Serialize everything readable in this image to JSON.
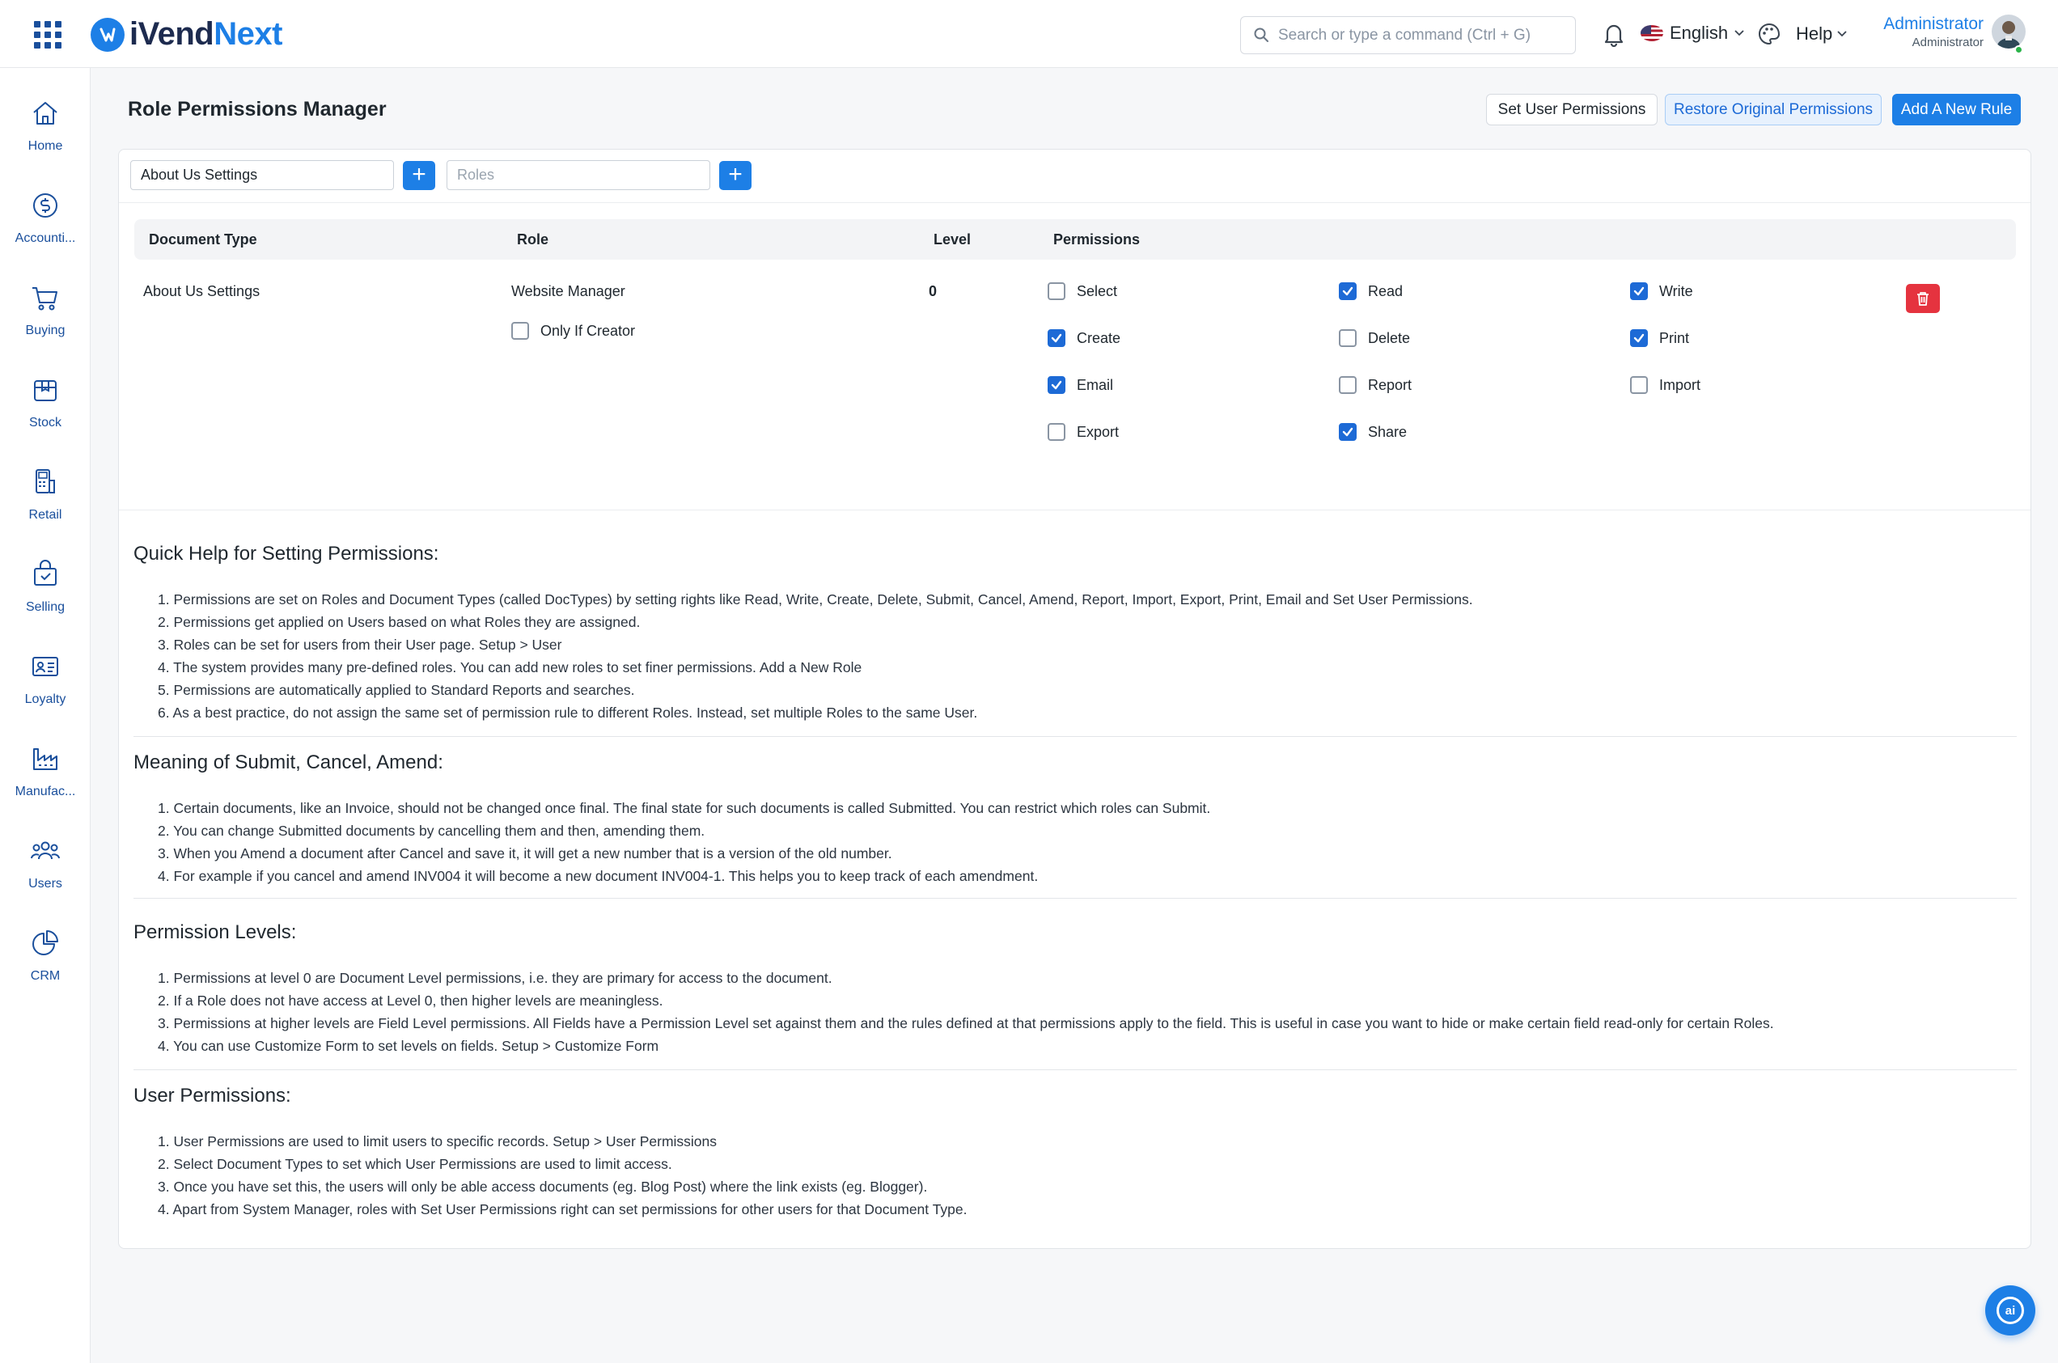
{
  "app": {
    "logo_left": "iVend",
    "logo_right": "Next",
    "search_placeholder": "Search or type a command (Ctrl + G)",
    "language": "English",
    "help_label": "Help",
    "user_name": "Administrator",
    "user_role": "Administrator",
    "brand_color": "#1d7fe6"
  },
  "sidebar": {
    "items": [
      {
        "label": "Home",
        "icon": "home-icon"
      },
      {
        "label": "Accounti...",
        "icon": "dollar-icon"
      },
      {
        "label": "Buying",
        "icon": "cart-icon"
      },
      {
        "label": "Stock",
        "icon": "box-icon"
      },
      {
        "label": "Retail",
        "icon": "pos-icon"
      },
      {
        "label": "Selling",
        "icon": "bag-icon"
      },
      {
        "label": "Loyalty",
        "icon": "id-card-icon"
      },
      {
        "label": "Manufac...",
        "icon": "factory-icon"
      },
      {
        "label": "Users",
        "icon": "users-icon"
      },
      {
        "label": "CRM",
        "icon": "pie-chart-icon"
      }
    ]
  },
  "page": {
    "title": "Role Permissions Manager",
    "buttons": {
      "set_user_permissions": "Set User Permissions",
      "restore": "Restore Original Permissions",
      "add_rule": "Add A New Rule"
    },
    "filters": {
      "doctype_value": "About Us Settings",
      "roles_placeholder": "Roles"
    }
  },
  "table": {
    "headers": {
      "document_type": "Document Type",
      "role": "Role",
      "level": "Level",
      "permissions": "Permissions"
    },
    "row": {
      "document_type": "About Us Settings",
      "role": "Website Manager",
      "only_if_creator": "Only If Creator",
      "only_if_creator_checked": false,
      "level": "0",
      "permissions": [
        {
          "label": "Select",
          "checked": false
        },
        {
          "label": "Read",
          "checked": true
        },
        {
          "label": "Write",
          "checked": true
        },
        {
          "label": "Create",
          "checked": true
        },
        {
          "label": "Delete",
          "checked": false
        },
        {
          "label": "Print",
          "checked": true
        },
        {
          "label": "Email",
          "checked": true
        },
        {
          "label": "Report",
          "checked": false
        },
        {
          "label": "Import",
          "checked": false
        },
        {
          "label": "Export",
          "checked": false
        },
        {
          "label": "Share",
          "checked": true
        }
      ]
    }
  },
  "help": {
    "sections": [
      {
        "title": "Quick Help for Setting Permissions:",
        "items": [
          "1. Permissions are set on Roles and Document Types (called DocTypes) by setting rights like Read, Write, Create, Delete, Submit, Cancel, Amend, Report, Import, Export, Print, Email and Set User Permissions.",
          "2. Permissions get applied on Users based on what Roles they are assigned.",
          "3. Roles can be set for users from their User page. Setup > User",
          "4. The system provides many pre-defined roles. You can add new roles to set finer permissions. Add a New Role",
          "5. Permissions are automatically applied to Standard Reports and searches.",
          "6. As a best practice, do not assign the same set of permission rule to different Roles. Instead, set multiple Roles to the same User."
        ]
      },
      {
        "title": "Meaning of Submit, Cancel, Amend:",
        "items": [
          "1. Certain documents, like an Invoice, should not be changed once final. The final state for such documents is called Submitted. You can restrict which roles can Submit.",
          "2. You can change Submitted documents by cancelling them and then, amending them.",
          "3. When you Amend a document after Cancel and save it, it will get a new number that is a version of the old number.",
          "4. For example if you cancel and amend INV004 it will become a new document INV004-1. This helps you to keep track of each amendment."
        ]
      },
      {
        "title": "Permission Levels:",
        "items": [
          "1. Permissions at level 0 are Document Level permissions, i.e. they are primary for access to the document.",
          "2. If a Role does not have access at Level 0, then higher levels are meaningless.",
          "3. Permissions at higher levels are Field Level permissions. All Fields have a Permission Level set against them and the rules defined at that permissions apply to the field. This is useful in case you want to hide or make certain field read-only for certain Roles.",
          "4. You can use Customize Form to set levels on fields. Setup > Customize Form"
        ]
      },
      {
        "title": "User Permissions:",
        "items": [
          "1. User Permissions are used to limit users to specific records. Setup > User Permissions",
          "2. Select Document Types to set which User Permissions are used to limit access.",
          "3. Once you have set this, the users will only be able access documents (eg. Blog Post) where the link exists (eg. Blogger).",
          "4. Apart from System Manager, roles with Set User Permissions right can set permissions for other users for that Document Type."
        ]
      }
    ]
  },
  "fab": {
    "label": "ai"
  }
}
